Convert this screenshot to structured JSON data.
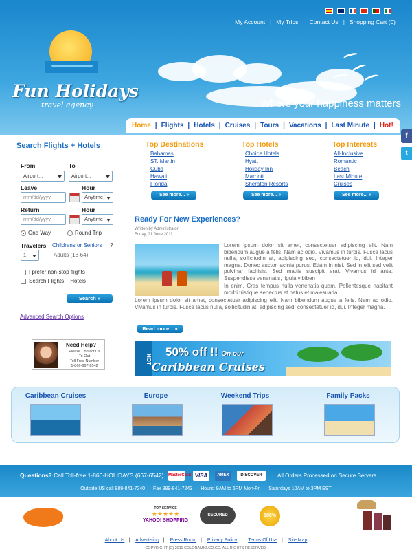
{
  "topbar": {
    "links": [
      "My Account",
      "My Trips",
      "Contact Us",
      "Shopping Cart (0)"
    ],
    "flags": [
      "es-flag-icon",
      "uk-flag-icon",
      "fr-flag-icon",
      "cn-flag-icon",
      "pt-flag-icon",
      "it-flag-icon"
    ]
  },
  "brand": {
    "name": "Fun Holidays",
    "subtitle": "travel agency",
    "tagline": "Where your happiness matters"
  },
  "nav": {
    "items": [
      "Home",
      "Flights",
      "Hotels",
      "Cruises",
      "Tours",
      "Vacations",
      "Last Minute",
      "Hot!"
    ]
  },
  "search": {
    "title": "Search Flights + Hotels",
    "from_label": "From",
    "to_label": "To",
    "from_value": "Airport...",
    "to_value": "Airport...",
    "leave_label": "Leave",
    "hour_label": "Hour",
    "return_label": "Return",
    "return_hour_label": "Hour",
    "date_placeholder": "mm/dd/yyyy",
    "hour_value": "Anytime",
    "one_way": "One Way",
    "round_trip": "Round Trip",
    "travelers_label": "Travelers",
    "children_link": "Childrens or Seniors",
    "question_mark": "?",
    "travelers_value": "1",
    "adults_note": "Adults (18-64)",
    "nonstop_label": "I prefer non-stop flights",
    "combo_label": "Search Flights + Hotels",
    "submit": "Search",
    "advanced": "Advanced Search Options"
  },
  "help": {
    "title": "Need Help?",
    "line1": "Please Contact Us",
    "line2": "To Out",
    "line3": "Toll Free Number",
    "phone": "1-866-667-6542"
  },
  "columns": [
    {
      "title": "Top Destinations",
      "items": [
        "Bahamas",
        "ST. Martin",
        "Cuba",
        "Hawaii",
        "Florida"
      ],
      "button": "See more..."
    },
    {
      "title": "Top Hotels",
      "items": [
        "Choice Hotels",
        "Hyatt",
        "Holiday Inn",
        "Marriott",
        "Sheraton Resorts"
      ],
      "button": "See more..."
    },
    {
      "title": "Top Interests",
      "items": [
        "All-Inclusive",
        "Romantic",
        "Beach",
        "Last Minute",
        "Cruises"
      ],
      "button": "See more..."
    }
  ],
  "article": {
    "title": "Ready For New Experiences?",
    "meta_author": "Written by Administrator",
    "meta_date": "Friday, 21 June 2011",
    "p1": "Lorem ipsum dolor sit amet, consectetuer adipiscing elit. Nam bibendum augue a felis. Nam ac odio. Vivamus in turpis. Fusce lacus nulla, sollicitudin at, adipiscing sed, consectetuer id, dui. Integer magna. Donec auctor lacinia purus. Etiam in nisi. Sed in elit sed velit pulvinar facilisis. Sed mattis suscipit erat. Vivamus id ante. Suspendisse venenatis, ligula vibiben",
    "p2": "In enim. Cras tempus nulla venenatis quam. Pellentesque habitant morbi tristique senectus et netus et malesuada",
    "p3": "Lorem ipsum dolor sit amet, consectetuer adipiscing elit. Nam bibendum augue a felis. Nam ac odio. Vivamus in turpis. Fusce lacus nulla, sollicitudin at, adipiscing sed, consectetuer id, dui. Integer magna.",
    "button": "Read more..."
  },
  "banner": {
    "tag": "HOT",
    "headline": "50% off !!",
    "on_our": "On our",
    "sub": "Caribbean Cruises"
  },
  "destinations": [
    {
      "title": "Caribbean Cruises"
    },
    {
      "title": "Europe"
    },
    {
      "title": "Weekend Trips"
    },
    {
      "title": "Family Packs"
    }
  ],
  "footer": {
    "questions_label": "Questions?",
    "tollfree": "Call Toll-free 1-866-HOLIDAYS (667-6542)",
    "cards": [
      "MasterCard",
      "VISA",
      "AMEX",
      "DISCOVER"
    ],
    "orders": "All Orders Processed on Secure Servers",
    "outside": "Outside US call 989-841-7240",
    "fax": "Fax 989-841-7243",
    "hours": "Hours: 9AM to 6PM Mon-Fri",
    "saturdays": "Saturdays 10AM to 3PM EST",
    "badge1": "TOP SERVICE",
    "badge1b": "YAHOO! SHOPPING",
    "badge2": "SECURED",
    "badge3": "100%",
    "links": [
      "About Us",
      "Advertising",
      "Press Room",
      "Privacy Policy",
      "Terms Of Use",
      "Site Map"
    ],
    "copyright": "COPYRIGHT (C) 2011 COLORAMIO.CO.CC. ALL RIGHTS RESERVED."
  },
  "social": [
    "f",
    "t"
  ]
}
